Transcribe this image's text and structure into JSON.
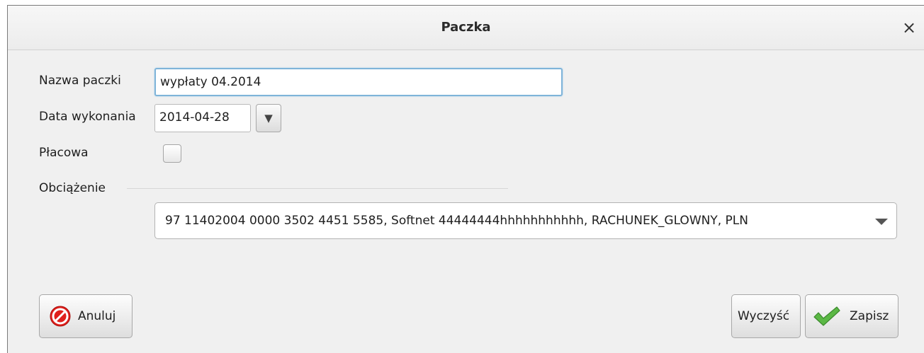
{
  "dialog": {
    "title": "Paczka",
    "close_glyph": "×"
  },
  "form": {
    "name_label": "Nazwa paczki",
    "name_value": "wypłaty 04.2014",
    "date_label": "Data wykonania",
    "date_value": "2014-04-28",
    "date_dropdown_glyph": "▼",
    "payroll_label": "Płacowa",
    "payroll_checked": false,
    "debit_section_label": "Obciążenie",
    "debit_account_value": "97 11402004 0000 3502 4451 5585, Softnet 44444444hhhhhhhhhhh, RACHUNEK_GLOWNY, PLN"
  },
  "buttons": {
    "cancel_label": "Anuluj",
    "clear_label": "Wyczyść",
    "save_label": "Zapisz"
  },
  "icons": {
    "close": "close-icon",
    "calendar_dropdown": "chevron-down-icon",
    "account_dropdown": "chevron-down-icon",
    "cancel": "cancel-icon",
    "save": "checkmark-icon"
  },
  "colors": {
    "cancel_icon": "#e0201c",
    "save_icon": "#5bb845",
    "focus_border": "#7fb4d9"
  }
}
